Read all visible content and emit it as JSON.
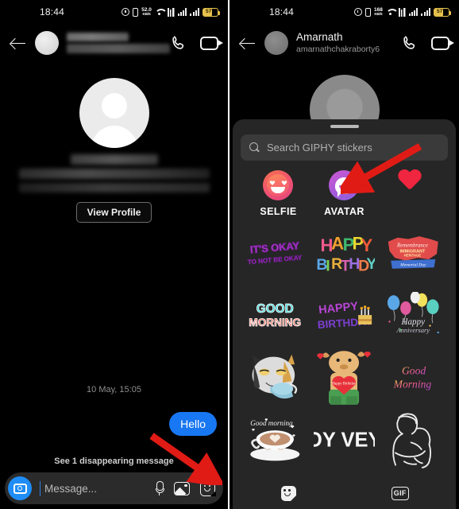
{
  "left_panel": {
    "status_bar": {
      "time": "18:44",
      "data_speed": "52.0",
      "data_unit": "KB/S",
      "battery_level": "57",
      "icons": [
        "alarm-icon",
        "vibrate-icon",
        "data-speed-icon",
        "wifi-icon",
        "sim-icon",
        "signal-icon",
        "signal-icon",
        "battery-icon"
      ]
    },
    "header": {
      "back_label": "Back",
      "name_redacted": "",
      "call_label": "Audio call",
      "video_label": "Video call"
    },
    "profile": {
      "view_profile_label": "View Profile"
    },
    "conversation": {
      "date_separator": "10 May, 15:05",
      "messages": [
        {
          "text": "Hello",
          "side": "sent"
        }
      ],
      "disappearing_note": "See 1 disappearing message"
    },
    "composer": {
      "placeholder": "Message...",
      "camera_label": "Camera",
      "mic_label": "Voice message",
      "gallery_label": "Gallery",
      "sticker_label": "Stickers"
    }
  },
  "right_panel": {
    "status_bar": {
      "time": "18:44",
      "data_speed": "168",
      "data_unit": "KB/S",
      "battery_level": "57"
    },
    "header": {
      "name": "Amarnath",
      "username": "amarnathchakraborty6"
    },
    "sticker_sheet": {
      "search_placeholder": "Search GIPHY stickers",
      "quick_actions": [
        {
          "label": "SELFIE",
          "icon": "selfie-emoji-icon"
        },
        {
          "label": "AVATAR",
          "icon": "avatar-face-icon"
        },
        {
          "label": "",
          "icon": "heart-sticker"
        }
      ],
      "stickers": [
        {
          "name": "its-okay-to-not-be-okay",
          "text": "IT'S OKAY TO NOT BE OKAY"
        },
        {
          "name": "happy-birthday-balloons",
          "text": "HAPPY BIRTHDAY"
        },
        {
          "name": "remembrance-immigrant-heritage",
          "text": "Remembrance Immigrant Heritage Memorial Day"
        },
        {
          "name": "good-morning-block",
          "text": "GOOD MORNING"
        },
        {
          "name": "happy-birthday-cake",
          "text": "HAPPY BIRTHDAY"
        },
        {
          "name": "happy-anniversary-balloons",
          "text": "Happy Anniversary"
        },
        {
          "name": "cat-drinking-tea",
          "text": ""
        },
        {
          "name": "bear-holding-heart",
          "text": "Happy Birthday"
        },
        {
          "name": "good-morning-script",
          "text": "Good Morning"
        },
        {
          "name": "good-morning-latte",
          "text": "Good morning"
        },
        {
          "name": "oy-vey",
          "text": "OY VEY"
        },
        {
          "name": "hug-line-art",
          "text": ""
        }
      ],
      "tabs": [
        {
          "label": "Stickers",
          "icon": "sticker-tab-icon",
          "selected": true
        },
        {
          "label": "GIF",
          "icon": "gif-tab-icon",
          "selected": false
        }
      ]
    }
  },
  "annotations": {
    "arrow_color": "#e01b15",
    "arrow_left_target": "sticker-icon in composer",
    "arrow_right_target": "AVATAR quick action"
  }
}
